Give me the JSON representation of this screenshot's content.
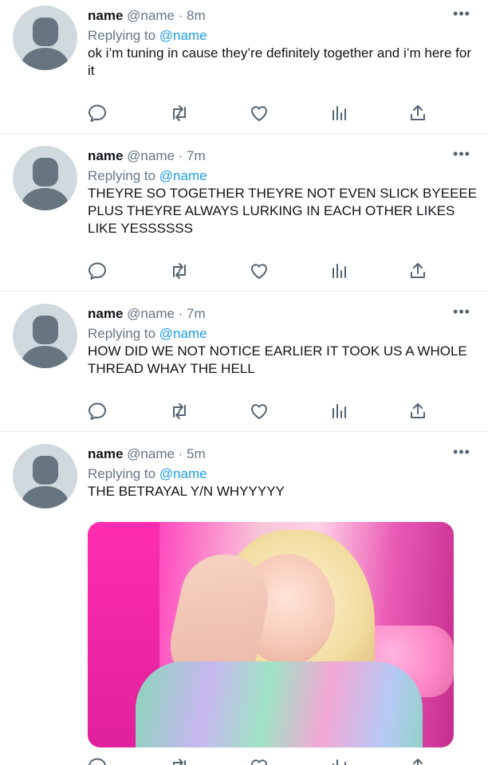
{
  "tweets": [
    {
      "name": "name",
      "meta": "@name · 8m",
      "replying_prefix": "Replying to",
      "replying_handle": "@name",
      "text": "ok i’m tuning in cause they’re definitely together and i’m here for it"
    },
    {
      "name": "name",
      "meta": "@name · 7m",
      "replying_prefix": "Replying to",
      "replying_handle": "@name",
      "text": "THEYRE SO TOGETHER THEYRE NOT EVEN SLICK BYEEEE PLUS THEYRE ALWAYS LURKING IN EACH OTHER LIKES LIKE YESSSSSS"
    },
    {
      "name": "name",
      "meta": "@name · 7m",
      "replying_prefix": "Replying to",
      "replying_handle": "@name",
      "text": "HOW DID WE NOT NOTICE EARLIER IT TOOK US A WHOLE THREAD WHAY THE HELL"
    },
    {
      "name": "name",
      "meta": "@name · 5m",
      "replying_prefix": "Replying to",
      "replying_handle": "@name",
      "text": "THE BETRAYAL Y/N WHYYYYY"
    }
  ],
  "more_glyph": "•••",
  "icons": {
    "reply": "reply-icon",
    "retweet": "retweet-icon",
    "like": "like-icon",
    "stats": "stats-icon",
    "share": "share-icon"
  },
  "colors": {
    "link": "#1d9bf0",
    "secondary": "#657786",
    "divider": "#e6ecf0",
    "avatar_bg": "#cfd9de",
    "avatar_fg": "#66757f"
  }
}
